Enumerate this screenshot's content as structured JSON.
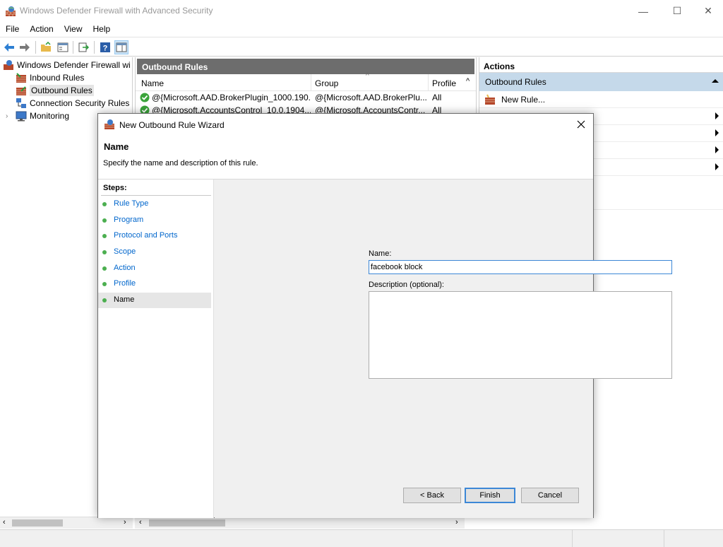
{
  "window": {
    "title": "Windows Defender Firewall with Advanced Security",
    "minimize": "—",
    "maximize": "☐",
    "close": "✕"
  },
  "menu": [
    "File",
    "Action",
    "View",
    "Help"
  ],
  "tree": {
    "root": "Windows Defender Firewall with Advanced Security",
    "items": [
      "Inbound Rules",
      "Outbound Rules",
      "Connection Security Rules",
      "Monitoring"
    ]
  },
  "middle": {
    "header": "Outbound Rules",
    "columns": [
      "Name",
      "Group",
      "Profile"
    ],
    "rows": [
      {
        "name": "@{Microsoft.AAD.BrokerPlugin_1000.190...",
        "group": "@{Microsoft.AAD.BrokerPlu...",
        "profile": "All"
      },
      {
        "name": "@{Microsoft.AccountsControl_10.0.1904...",
        "group": "@{Microsoft.AccountsContr...",
        "profile": "All"
      }
    ]
  },
  "actions": {
    "header": "Actions",
    "section": "Outbound Rules",
    "new_rule": "New Rule..."
  },
  "wizard": {
    "title": "New Outbound Rule Wizard",
    "heading": "Name",
    "subtitle": "Specify the name and description of this rule.",
    "steps_title": "Steps:",
    "steps": [
      "Rule Type",
      "Program",
      "Protocol and Ports",
      "Scope",
      "Action",
      "Profile",
      "Name"
    ],
    "name_label": "Name:",
    "name_value": "facebook block",
    "desc_label": "Description (optional):",
    "back": "< Back",
    "finish": "Finish",
    "cancel": "Cancel"
  }
}
